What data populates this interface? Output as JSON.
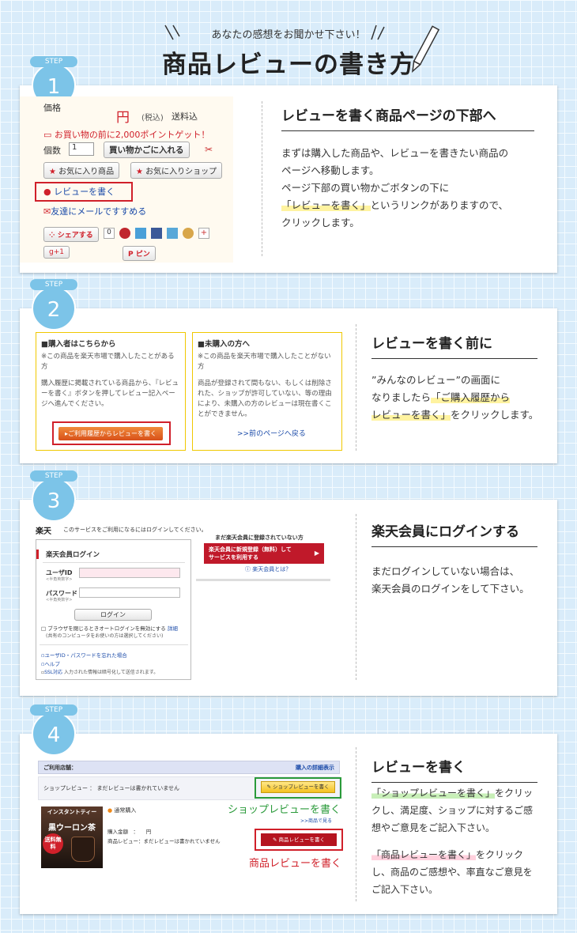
{
  "header": {
    "subtitle": "あなたの感想をお聞かせ下さい！",
    "title": "商品レビューの書き方"
  },
  "step_label": "STEP",
  "colors": {
    "accent": "#7cc4e8",
    "red": "#d0202a",
    "green": "#2a9a3a"
  },
  "step1": {
    "num": "1",
    "price_label": "価格",
    "yen": "円",
    "tax": "(税込)",
    "shipping": "送料込",
    "points": "お買い物の前に2,000ポイントゲット！",
    "qty_label": "個数",
    "qty_value": "1",
    "cart_btn": "買い物かごに入れる",
    "fav_item": "お気に入り商品",
    "fav_shop": "お気に入りショップ",
    "review_link": "レビューを書く",
    "mail_link": "友達にメールですすめる",
    "share": "シェアする",
    "share_count": "0",
    "gplus": "+1",
    "pin": "ピン",
    "title": "レビューを書く商品ページの下部へ",
    "text1": "まずは購入した商品や、レビューを書きたい商品の",
    "text2": "ページへ移動します。",
    "text3": "ページ下部の買い物かごボタンの下に",
    "text4_hl": "「レビューを書く」",
    "text4": "というリンクがありますので、",
    "text5": "クリックします。"
  },
  "step2": {
    "num": "2",
    "box1": {
      "title": "■購入者はこちらから",
      "p1": "※この商品を楽天市場で購入したことがある方",
      "p2": "購入履歴に掲載されている商品から、『レビューを書く』ボタンを押してレビュー記入ページへ進んでください。",
      "btn": "ご利用履歴からレビューを書く"
    },
    "box2": {
      "title": "■未購入の方へ",
      "p1": "※この商品を楽天市場で購入したことがない方",
      "p2": "商品が登録されて間もない、もしくは削除された、ショップが許可していない、等の理由により、未購入の方のレビューは現在書くことができません。",
      "link": ">>前のページへ戻る"
    },
    "title": "レビューを書く前に",
    "text1": "”みんなのレビュー”の画面に",
    "text2": "なりましたら",
    "text2_hl": "「ご購入履歴から",
    "text3_hl": "レビューを書く」",
    "text3": "をクリックします。"
  },
  "step3": {
    "num": "3",
    "logo": "楽天",
    "notice": "このサービスをご利用になるにはログインしてください。",
    "login_title": "楽天会員ログイン",
    "uid": "ユーザID",
    "uid_sub": "<半角英数字>",
    "pw": "パスワード",
    "pw_sub": "<半角英数字>",
    "login_btn": "ログイン",
    "auto": "ブラウザを閉じるときオートログインを無効にする",
    "detail": "詳細",
    "shared": "(共有のコンピュータをお使いの方は選択してください)",
    "forgot": "ユーザID・パスワードを忘れた場合",
    "help": "ヘルプ",
    "ssl": "SSL対応",
    "ssl_note": "入力された情報は暗号化して送信されます。",
    "not_member": "まだ楽天会員に登録されていない方",
    "register_btn1": "楽天会員に新規登録（無料）して",
    "register_btn2": "サービスを利用する",
    "what": "楽天会員とは？",
    "title": "楽天会員にログインする",
    "text1": "まだログインしていない場合は、",
    "text2": "楽天会員のログインをして下さい。"
  },
  "step4": {
    "num": "4",
    "shop_label": "ご利用店舗：",
    "history_link": "購入の詳細表示",
    "shop_review_label": "ショップレビュー ： まだレビューは書かれていません",
    "shop_review_btn": "ショップレビューを書く",
    "shop_caption": "ショップレビューを書く",
    "normal": "通常購入",
    "detail": ">>商品で見る",
    "amount": "購入金額　：　　円",
    "item_review_label": "商品レビュー：まだレビューは書かれていません",
    "item_review_btn": "商品レビューを書く",
    "item_caption": "商品レビューを書く",
    "product_line1": "インスタントティー",
    "product_line2": "黒ウーロン茶",
    "product_tag": "送料無料",
    "title": "レビューを書く",
    "t1_hl": "「ショップレビューを書く」",
    "t1": "をクリッ",
    "t2": "クし、満足度、ショップに対するご感",
    "t3": "想やご意見をご記入下さい。",
    "t4_hl": "「商品レビューを書く」",
    "t4": "をクリック",
    "t5": "し、商品のご感想や、率直なご意見を",
    "t6": "ご記入下さい。"
  }
}
